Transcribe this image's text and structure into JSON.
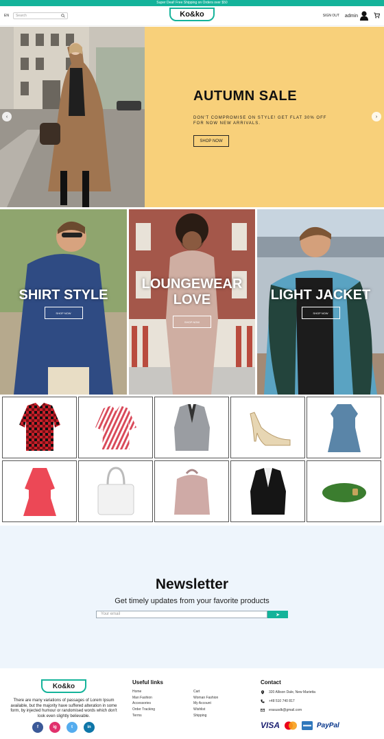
{
  "promo": {
    "text": "Super Deal! Free Shipping on Orders over $50"
  },
  "header": {
    "lang": "EN",
    "search_placeholder": "Search",
    "logo": "Ko&ko",
    "signout": "SIGN OUT",
    "user": "admin"
  },
  "hero": {
    "title": "AUTUMN SALE",
    "subtitle": "DON'T COMPROMISE ON STYLE! GET FLAT 30% OFF FOR NOW NEW ARRIVALS.",
    "button": "SHOP NOW",
    "prev": "‹",
    "next": "›"
  },
  "categories": [
    {
      "title": "SHIRT STYLE",
      "button": "SHOP NOW"
    },
    {
      "title": "LOUNGEWEAR LOVE",
      "button": "SHOP NOW"
    },
    {
      "title": "LIGHT JACKET",
      "button": "SHOP NOW"
    }
  ],
  "products": [
    {
      "icon": "plaid-shirt-icon"
    },
    {
      "icon": "striped-blouse-icon"
    },
    {
      "icon": "grey-blazer-icon"
    },
    {
      "icon": "clear-heel-icon"
    },
    {
      "icon": "blue-dress-icon"
    },
    {
      "icon": "red-dress-icon"
    },
    {
      "icon": "white-handbag-icon"
    },
    {
      "icon": "pink-backpack-icon"
    },
    {
      "icon": "black-blazer-icon"
    },
    {
      "icon": "green-pouch-icon"
    }
  ],
  "newsletter": {
    "title": "Newsletter",
    "subtitle": "Get timely updates from your favorite products",
    "placeholder": "Your email",
    "send": "➤"
  },
  "footer": {
    "logo": "Ko&ko",
    "description": "There are many variations of passages of Lorem Ipsum available, but the majority have suffered alteration in some form, by injected humour or randomised words which don't look even slightly believable.",
    "socials": [
      "f",
      "ig",
      "t",
      "in"
    ],
    "useful_links_title": "Useful links",
    "links_col1": [
      "Home",
      "Man Fashion",
      "Accessories",
      "Order Tracking",
      "Terms"
    ],
    "links_col2": [
      "Cart",
      "Woman Fashion",
      "My Account",
      "Wishlist",
      "Shipping"
    ],
    "contact_title": "Contact",
    "address": "320 Allison Dale, New Marietta",
    "phone": "+48 510 740 817",
    "email": "erasusdk@gmail.com",
    "payments": [
      "VISA",
      "PayPal"
    ]
  },
  "colors": {
    "accent": "#14b39a",
    "hero_panel": "#f8d07a",
    "newsletter_bg": "#eef5fc"
  }
}
